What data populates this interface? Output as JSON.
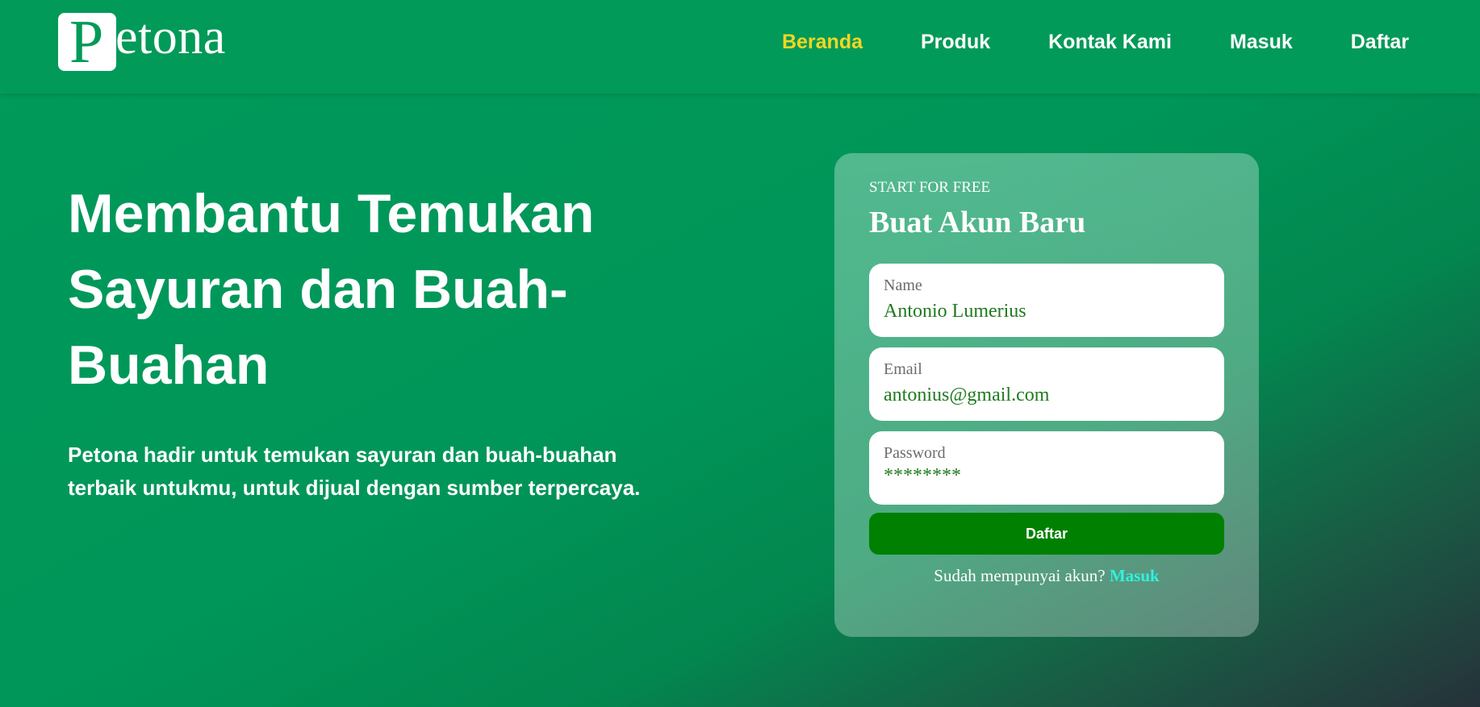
{
  "brand": {
    "name": "Petona",
    "logo_initial": "P"
  },
  "nav": {
    "items": [
      {
        "label": "Beranda",
        "active": true
      },
      {
        "label": "Produk",
        "active": false
      },
      {
        "label": "Kontak Kami",
        "active": false
      },
      {
        "label": "Masuk",
        "active": false
      },
      {
        "label": "Daftar",
        "active": false
      }
    ]
  },
  "hero": {
    "title": "Membantu Temukan Sayuran dan Buah-Buahan",
    "description": "Petona hadir untuk temukan sayuran dan buah-buahan terbaik untukmu, untuk dijual dengan sumber terpercaya."
  },
  "form": {
    "eyebrow": "START FOR FREE",
    "title": "Buat Akun Baru",
    "fields": {
      "name": {
        "label": "Name",
        "value": "Antonio Lumerius"
      },
      "email": {
        "label": "Email",
        "value": "antonius@gmail.com"
      },
      "password": {
        "label": "Password",
        "value": "********"
      }
    },
    "submit_label": "Daftar",
    "login_prompt": "Sudah mempunyai akun?",
    "login_link": "Masuk"
  },
  "colors": {
    "primary_green": "#029a58",
    "active_nav": "#f5d623",
    "button_green": "#008000",
    "link_cyan": "#2ef2e0",
    "input_text": "#1f7a1f"
  }
}
